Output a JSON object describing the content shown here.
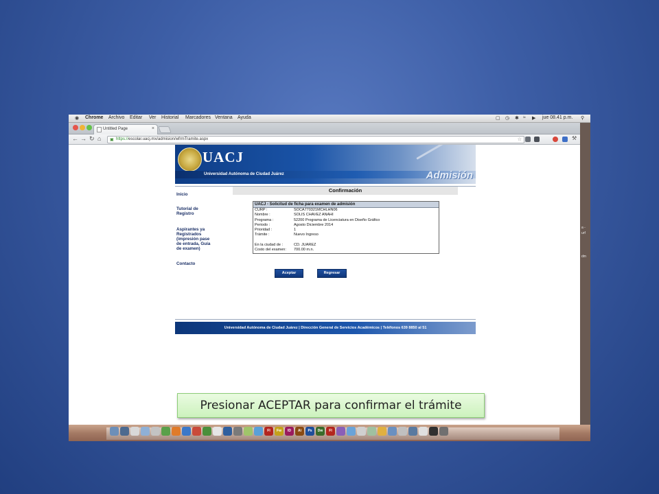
{
  "menubar": {
    "apple": "",
    "items": [
      "Chrome",
      "Archivo",
      "Editar",
      "Ver",
      "Historial",
      "Marcadores",
      "Ventana",
      "Ayuda"
    ],
    "clock": "jue 08.41 p.m."
  },
  "browser": {
    "tab_title": "Untitled Page",
    "url_scheme": "https://",
    "url_rest": "escolar.uacj.mx/admision/wfrmTramite.aspx"
  },
  "banner": {
    "brand": "UACJ",
    "full_name": "Universidad Autónoma de Ciudad Juárez",
    "section": "Admisión"
  },
  "sidebar": {
    "inicio": "Inicio",
    "tutorial_1": "Tutorial de",
    "tutorial_2": "Registro",
    "aspirantes_1": "Aspirantes ya",
    "aspirantes_2": "Registrados",
    "aspirantes_3": "(impresión pase",
    "aspirantes_4": "de entrada, Guía",
    "aspirantes_5": "de examen)",
    "contacto": "Contacto"
  },
  "confirmation": {
    "title": "Confirmación",
    "box_header": "UACJ - Solicitud de ficha para examen de admisión",
    "rows": [
      {
        "label": "CURP :",
        "value": "SOCA770321MCHLHN06"
      },
      {
        "label": "Nombre :",
        "value": "SOLIS CHAVEZ ANAHI"
      },
      {
        "label": "Programa :",
        "value": "52200 Programa de Licenciatura en Diseño Gráfico"
      },
      {
        "label": "Periodo :",
        "value": "Agosto Diciembre 2014"
      },
      {
        "label": "Prioridad :",
        "value": "1"
      },
      {
        "label": "Trámite :",
        "value": "Nuevo Ingreso"
      },
      {
        "label": "",
        "value": ""
      },
      {
        "label": "En la ciudad de :",
        "value": "CD. JUAREZ"
      },
      {
        "label": "Costo del examen:",
        "value": "700.00 m.n."
      }
    ],
    "accept_label": "Aceptar",
    "back_label": "Regresar"
  },
  "footer": {
    "text": "Universidad Autónoma de Ciudad Juárez | Dirección General de Servicios Académicos | Teléfonos 639 8850 al 51"
  },
  "callout": {
    "text": "Presionar ACEPTAR para confirmar el trámite"
  },
  "side_strip": {
    "line_1": "a -",
    "line_2": "urf",
    "line_3": "dm"
  },
  "dock": {
    "apps": [
      "Fl",
      "Fw",
      "ID",
      "Ai",
      "Ps",
      "Dw",
      "Fl"
    ]
  },
  "colors": {
    "slide_bg": "#3d5ea6",
    "uacj_blue": "#1a54a8",
    "button_blue": "#1e4fa0",
    "callout_green": "#ccf2bd"
  }
}
